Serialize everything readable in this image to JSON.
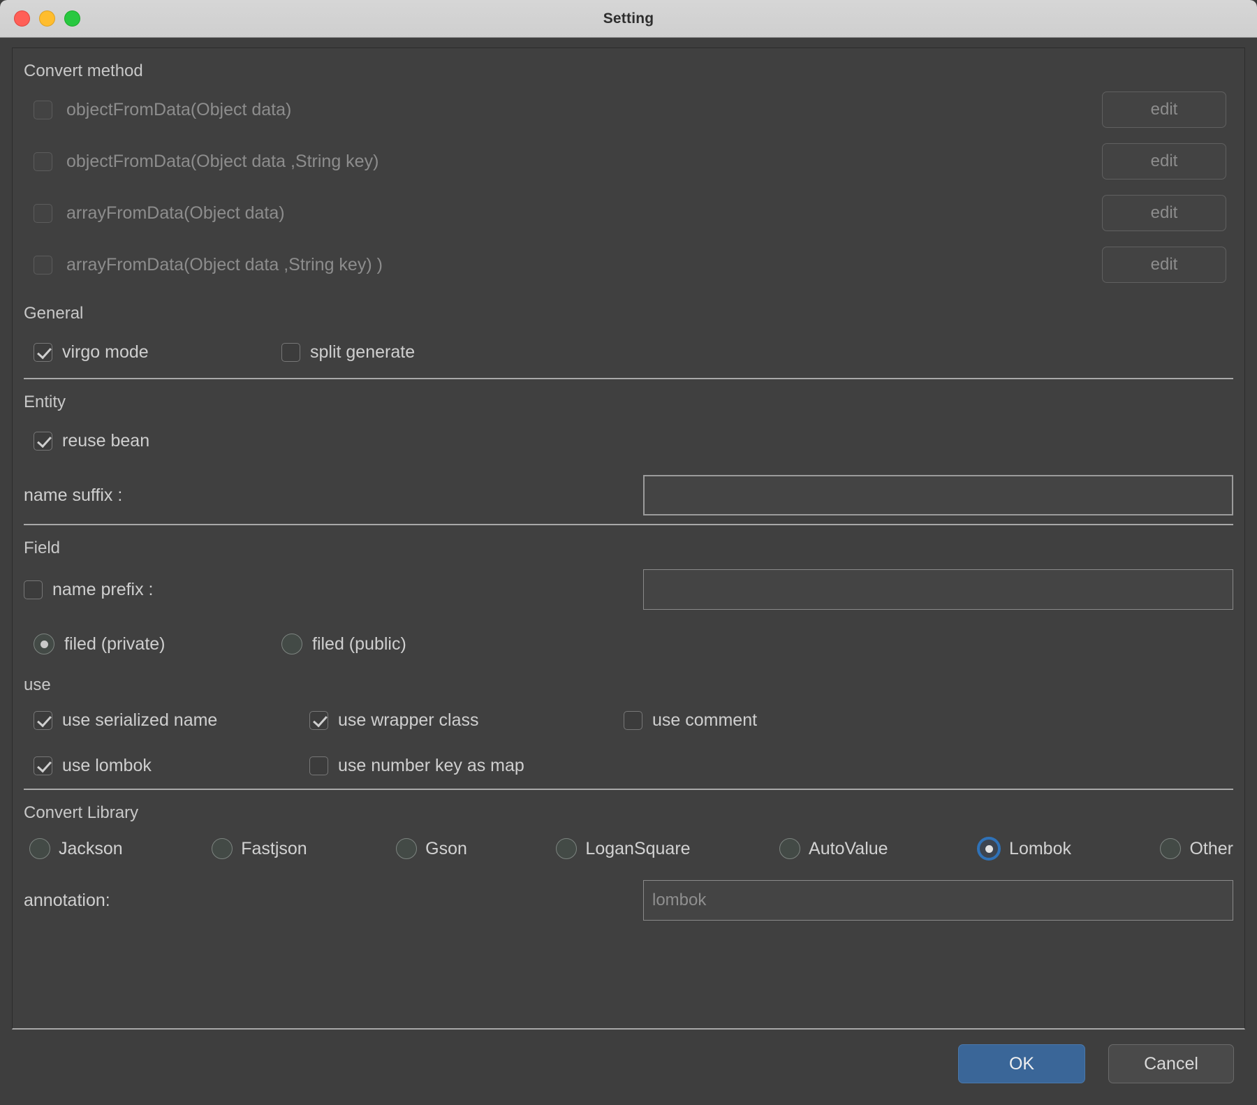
{
  "window": {
    "title": "Setting",
    "traffic_lights": [
      {
        "name": "close",
        "color": "#ff5f57"
      },
      {
        "name": "minimize",
        "color": "#ffbd2e"
      },
      {
        "name": "zoom",
        "color": "#28c840"
      }
    ]
  },
  "sections": {
    "convert_method": {
      "title": "Convert method",
      "items": [
        {
          "label": "objectFromData(Object data)",
          "checked": false,
          "enabled": false,
          "edit_label": "edit"
        },
        {
          "label": "objectFromData(Object data ,String key)",
          "checked": false,
          "enabled": false,
          "edit_label": "edit"
        },
        {
          "label": "arrayFromData(Object data)",
          "checked": false,
          "enabled": false,
          "edit_label": "edit"
        },
        {
          "label": "arrayFromData(Object data ,String key) )",
          "checked": false,
          "enabled": false,
          "edit_label": "edit"
        }
      ]
    },
    "general": {
      "title": "General",
      "items": [
        {
          "label": "virgo mode",
          "checked": true
        },
        {
          "label": "split generate",
          "checked": false
        }
      ]
    },
    "entity": {
      "title": "Entity",
      "reuse_bean": {
        "label": "reuse bean",
        "checked": true
      },
      "name_suffix": {
        "label": "name suffix :",
        "value": "",
        "placeholder": ""
      }
    },
    "field": {
      "title": "Field",
      "name_prefix": {
        "label": "name prefix :",
        "checked": false,
        "value": "",
        "placeholder": ""
      },
      "visibility": {
        "options": [
          {
            "label": "filed (private)",
            "selected": true
          },
          {
            "label": "filed (public)",
            "selected": false
          }
        ]
      },
      "use": {
        "title": "use",
        "items": [
          {
            "label": "use serialized name",
            "checked": true
          },
          {
            "label": "use wrapper class",
            "checked": true
          },
          {
            "label": "use comment",
            "checked": false
          },
          {
            "label": "use lombok",
            "checked": true
          },
          {
            "label": "use number key as map",
            "checked": false
          }
        ]
      }
    },
    "convert_library": {
      "title": "Convert Library",
      "options": [
        {
          "label": "Jackson",
          "selected": false,
          "focused": false
        },
        {
          "label": "Fastjson",
          "selected": false,
          "focused": false
        },
        {
          "label": "Gson",
          "selected": false,
          "focused": false
        },
        {
          "label": "LoganSquare",
          "selected": false,
          "focused": false
        },
        {
          "label": "AutoValue",
          "selected": false,
          "focused": false
        },
        {
          "label": "Lombok",
          "selected": true,
          "focused": true
        },
        {
          "label": "Other",
          "selected": false,
          "focused": false
        }
      ],
      "annotation": {
        "label": "annotation:",
        "value": "",
        "placeholder": "lombok"
      }
    }
  },
  "footer": {
    "ok_label": "OK",
    "cancel_label": "Cancel"
  },
  "colors": {
    "accent": "#3a6698",
    "focus_ring": "#2f72b8",
    "panel_bg": "#404040",
    "window_bg": "#3e3e3e",
    "titlebar_bg": "#d6d6d6"
  }
}
